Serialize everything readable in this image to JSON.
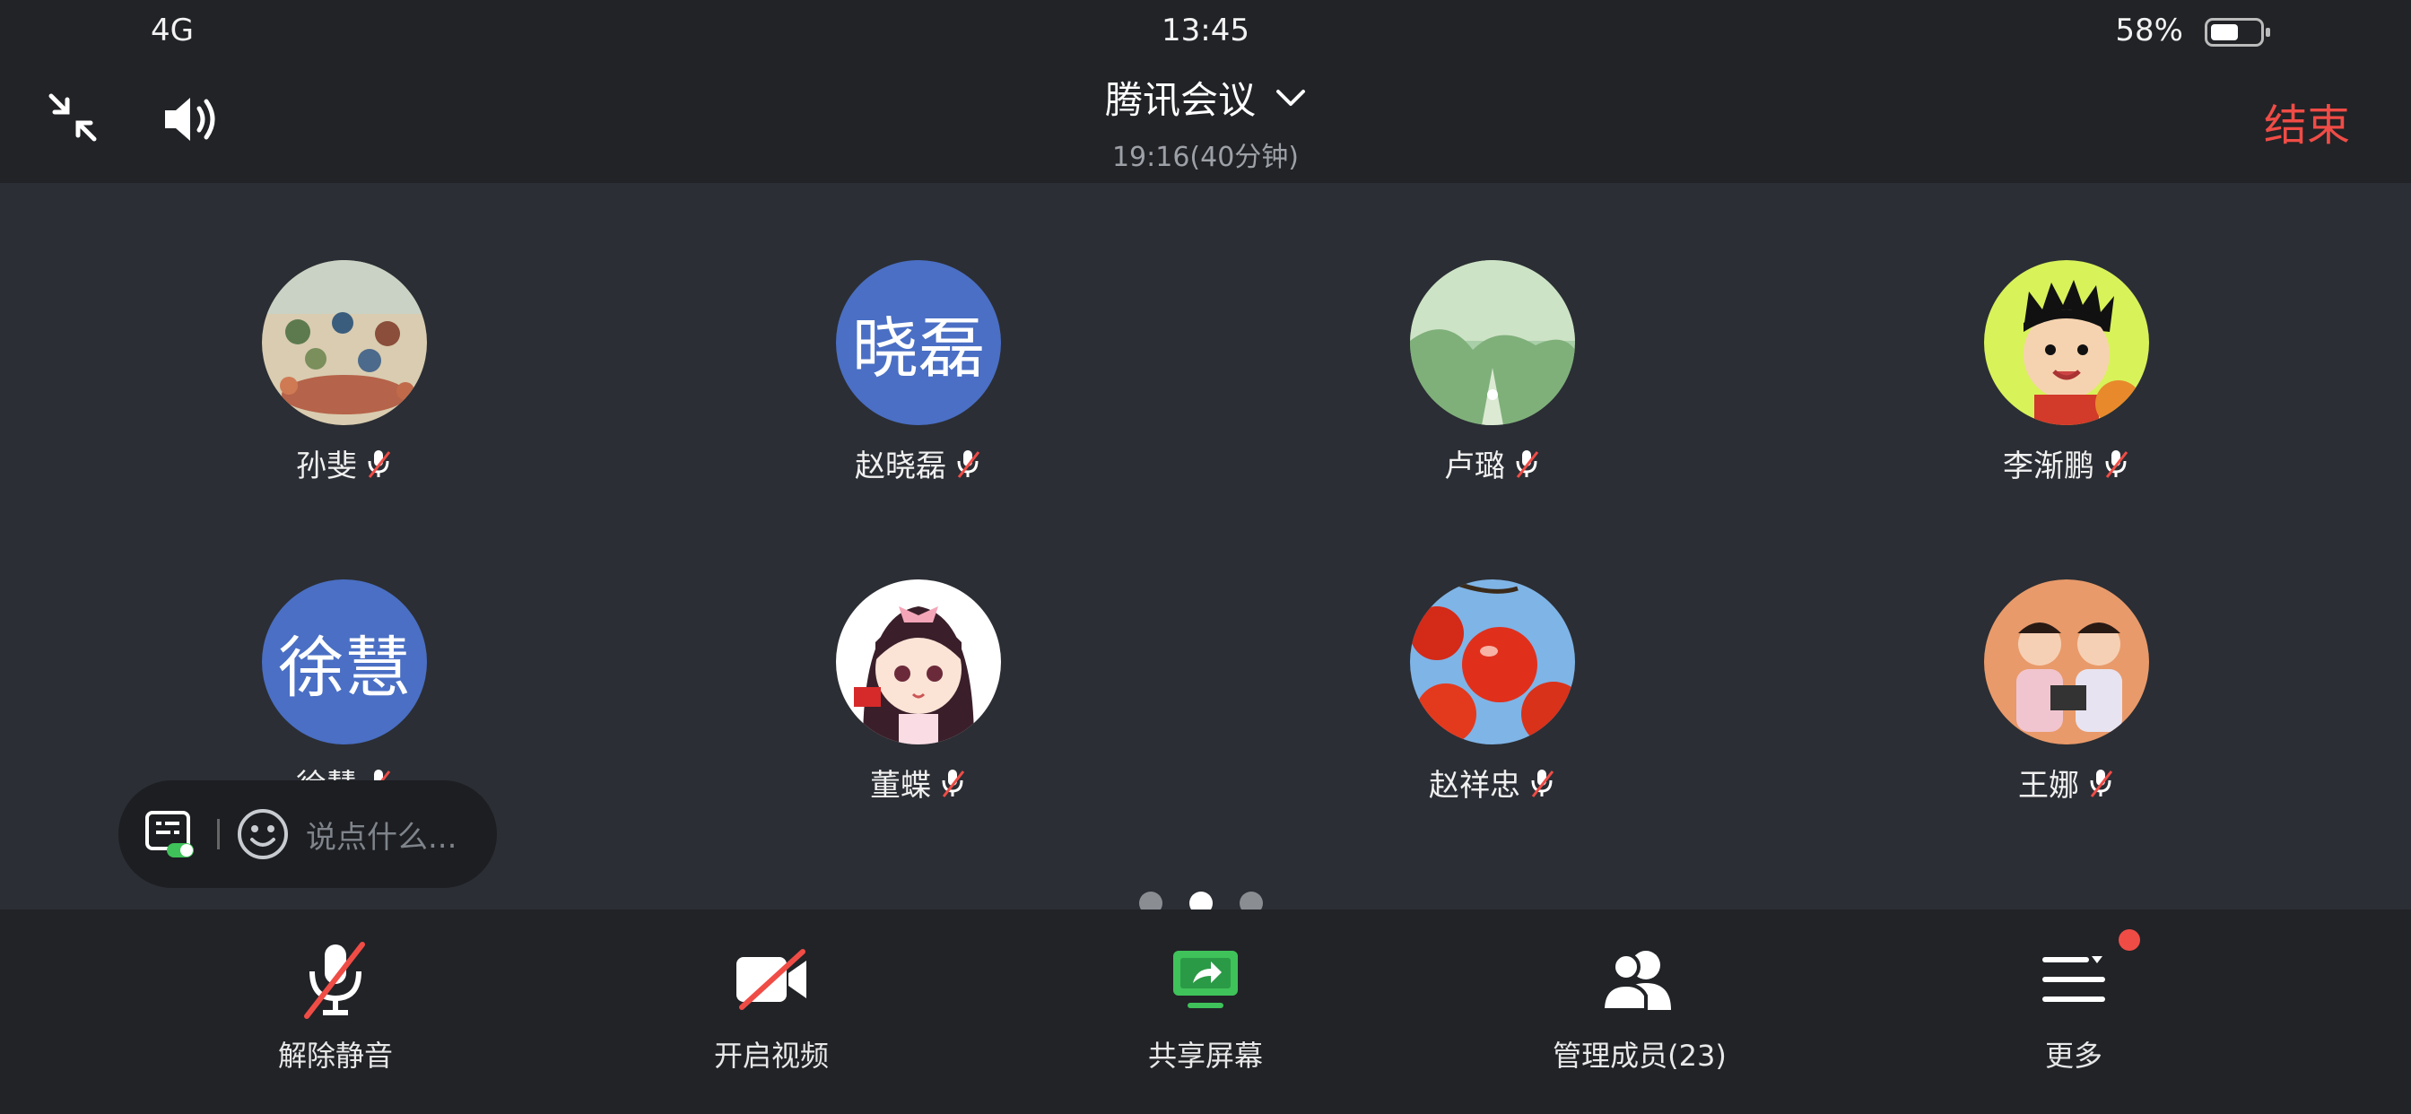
{
  "status_bar": {
    "carrier": "4G",
    "time": "13:45",
    "battery_percent": "58%",
    "battery_level": 0.58
  },
  "header": {
    "title": "腾讯会议",
    "subtitle": "19:16(40分钟)",
    "end_label": "结束"
  },
  "participants": [
    {
      "name": "孙斐",
      "avatar_type": "photo-painting",
      "muted": true
    },
    {
      "name": "赵晓磊",
      "avatar_text": "晓磊",
      "avatar_type": "text",
      "muted": true
    },
    {
      "name": "卢璐",
      "avatar_type": "photo-forest",
      "muted": true
    },
    {
      "name": "李渐鹏",
      "avatar_type": "cartoon-boy",
      "muted": true
    },
    {
      "name": "徐慧",
      "avatar_text": "徐慧",
      "avatar_type": "text",
      "muted": true
    },
    {
      "name": "董蝶",
      "avatar_type": "cartoon-girl",
      "muted": true
    },
    {
      "name": "赵祥忠",
      "avatar_type": "photo-persimmon",
      "muted": true
    },
    {
      "name": "王娜",
      "avatar_type": "photo-kids",
      "muted": true
    }
  ],
  "chat": {
    "placeholder": "说点什么..."
  },
  "pagination": {
    "pages": 3,
    "current": 2
  },
  "toolbar": {
    "unmute": "解除静音",
    "video": "开启视频",
    "share": "共享屏幕",
    "members": "管理成员(23)",
    "more": "更多"
  },
  "colors": {
    "accent_red": "#f04c46",
    "share_green": "#3fc25a",
    "text_avatar_blue": "#4a6fc4"
  }
}
